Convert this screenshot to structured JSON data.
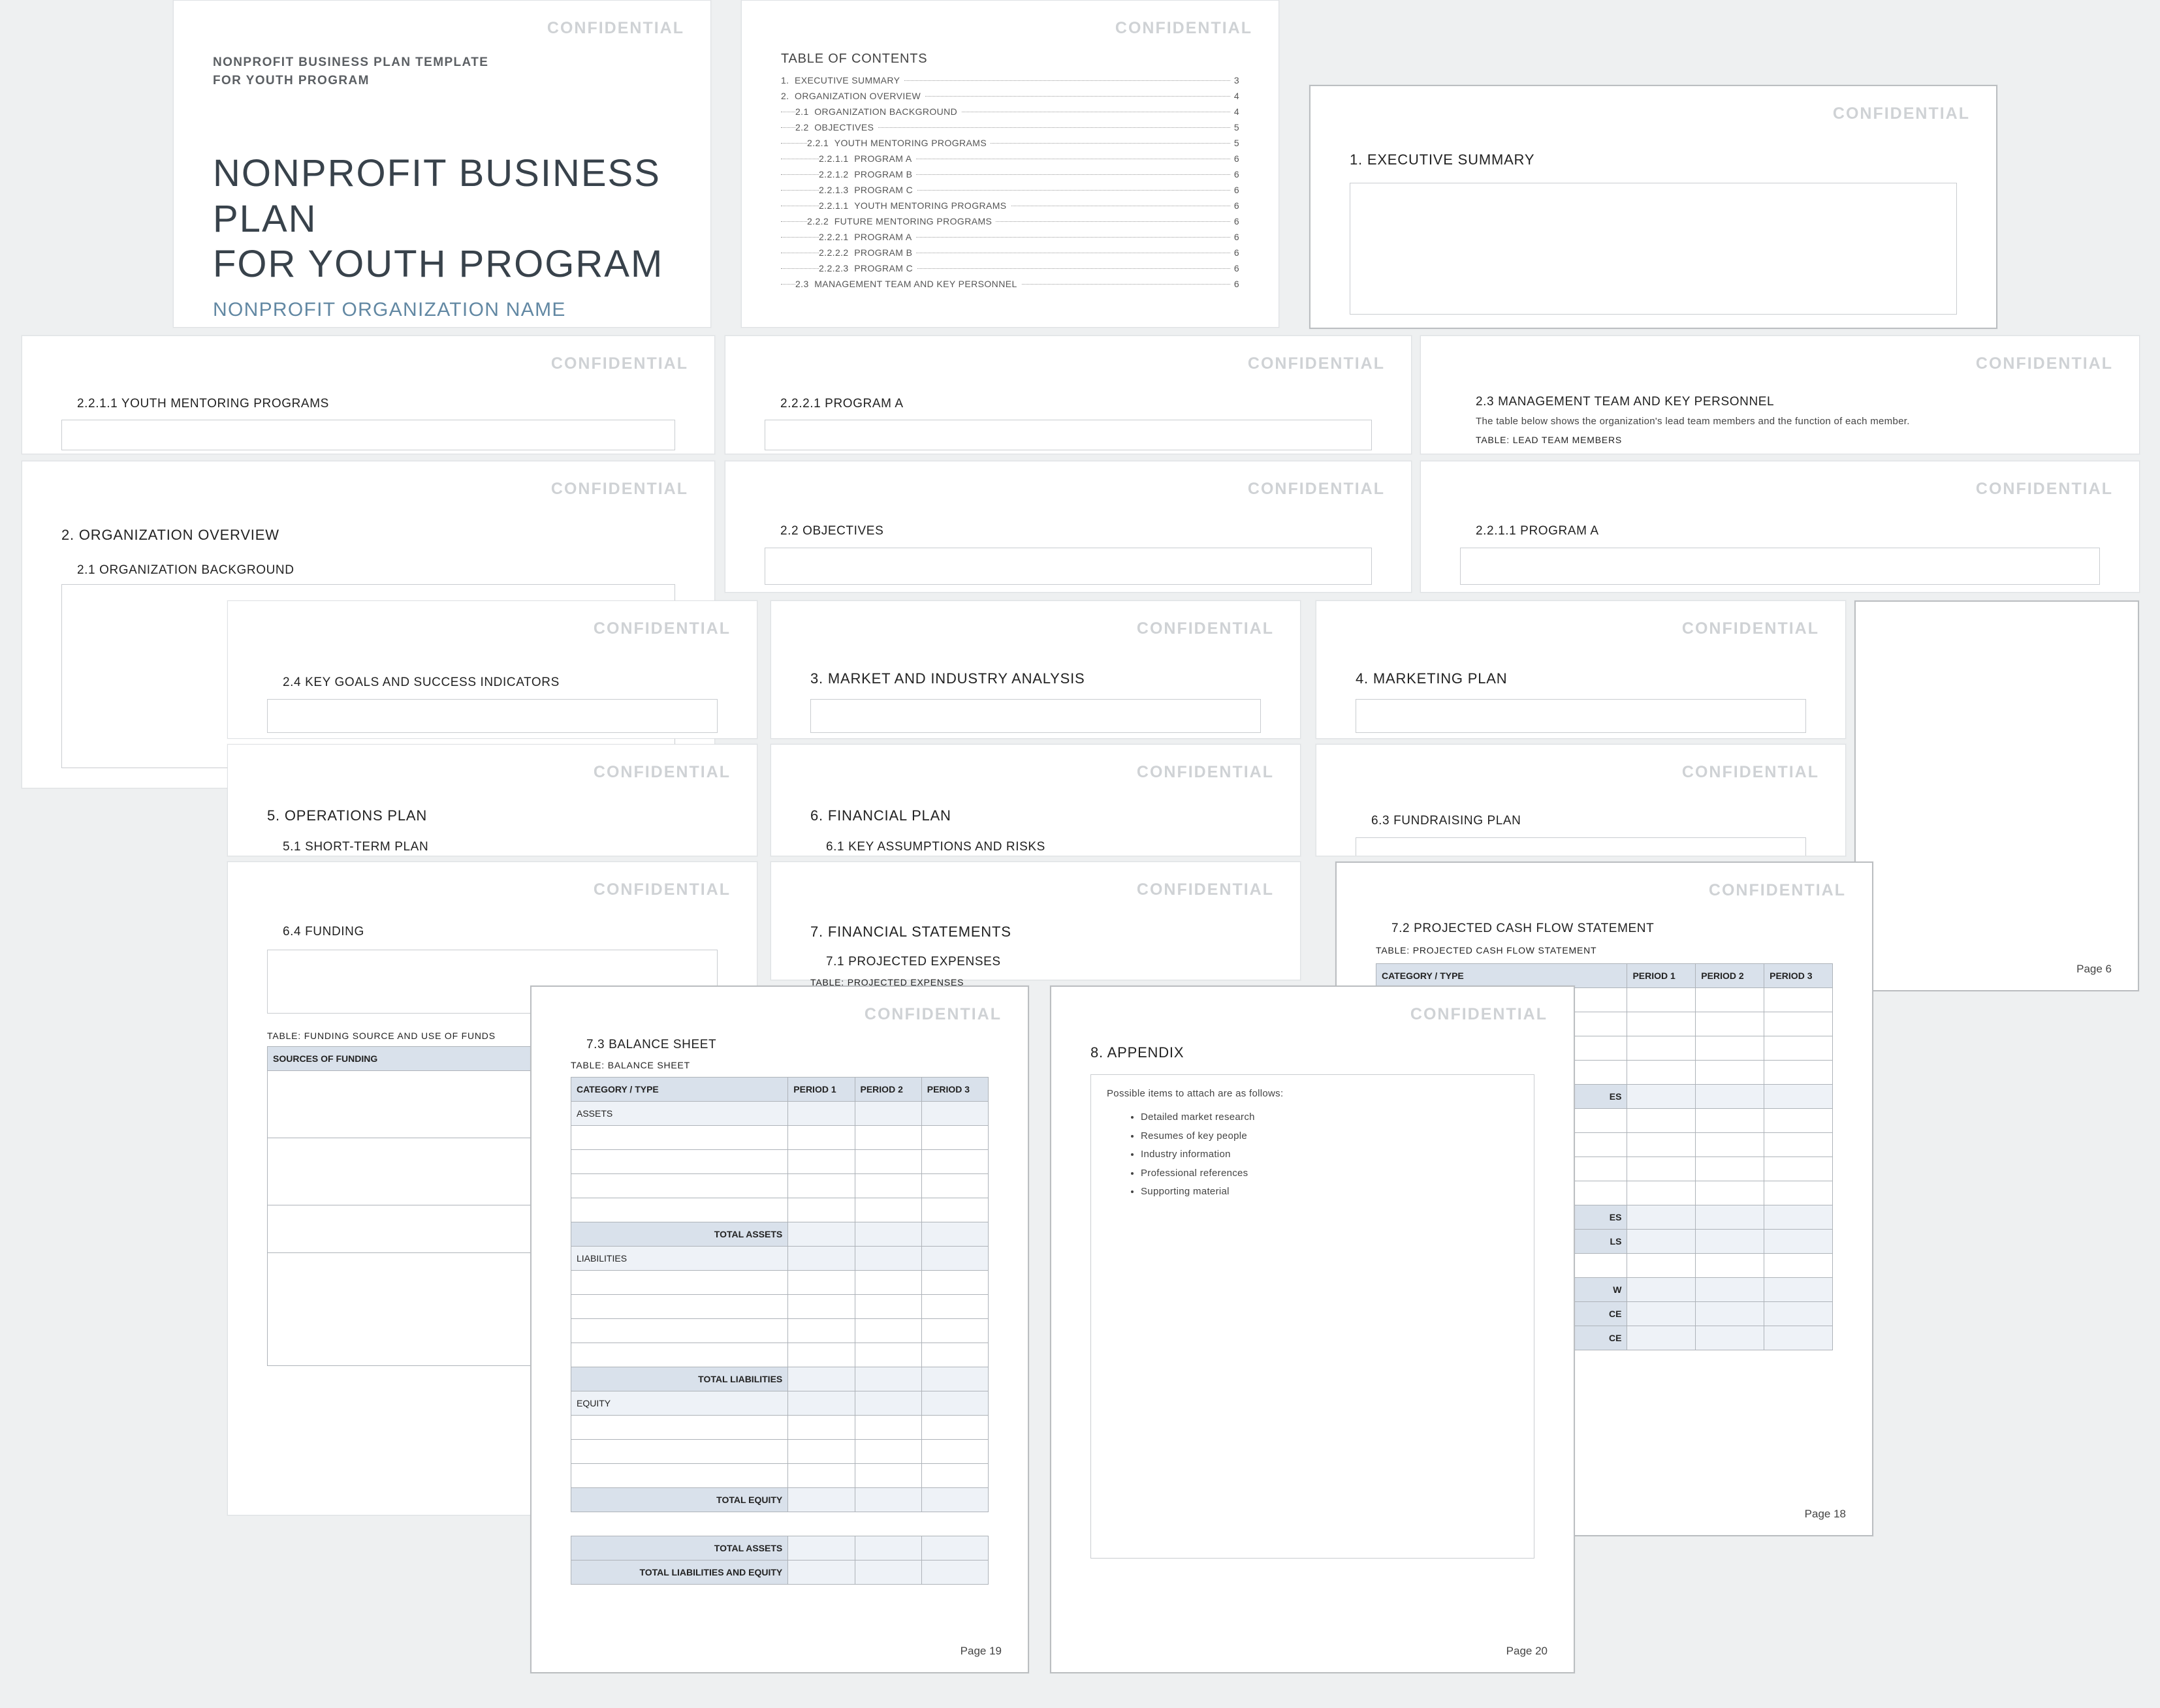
{
  "confidential": "CONFIDENTIAL",
  "cover": {
    "template_line1": "NONPROFIT BUSINESS PLAN TEMPLATE",
    "template_line2": "FOR YOUTH PROGRAM",
    "title_line1": "NONPROFIT BUSINESS PLAN",
    "title_line2": "FOR YOUTH PROGRAM",
    "org_name": "NONPROFIT ORGANIZATION NAME"
  },
  "toc": {
    "heading": "TABLE OF CONTENTS",
    "items": [
      {
        "n": "1.",
        "t": "EXECUTIVE SUMMARY",
        "p": "3"
      },
      {
        "n": "2.",
        "t": "ORGANIZATION OVERVIEW",
        "p": "4"
      },
      {
        "n": "2.1",
        "t": "ORGANIZATION BACKGROUND",
        "p": "4"
      },
      {
        "n": "2.2",
        "t": "OBJECTIVES",
        "p": "5"
      },
      {
        "n": "2.2.1",
        "t": "YOUTH MENTORING PROGRAMS",
        "p": "5"
      },
      {
        "n": "2.2.1.1",
        "t": "PROGRAM A",
        "p": "6"
      },
      {
        "n": "2.2.1.2",
        "t": "PROGRAM B",
        "p": "6"
      },
      {
        "n": "2.2.1.3",
        "t": "PROGRAM C",
        "p": "6"
      },
      {
        "n": "2.2.1.1",
        "t": "YOUTH MENTORING PROGRAMS",
        "p": "6"
      },
      {
        "n": "2.2.2",
        "t": "FUTURE MENTORING PROGRAMS",
        "p": "6"
      },
      {
        "n": "2.2.2.1",
        "t": "PROGRAM A",
        "p": "6"
      },
      {
        "n": "2.2.2.2",
        "t": "PROGRAM B",
        "p": "6"
      },
      {
        "n": "2.2.2.3",
        "t": "PROGRAM C",
        "p": "6"
      },
      {
        "n": "2.3",
        "t": "MANAGEMENT TEAM AND KEY PERSONNEL",
        "p": "6"
      }
    ]
  },
  "sections": {
    "exec_summary": "1.  EXECUTIVE SUMMARY",
    "youth_ment": "2.2.1.1   YOUTH MENTORING PROGRAMS",
    "p2221": "2.2.2.1   PROGRAM A",
    "mgmt_team": "2.3   MANAGEMENT TEAM AND KEY PERSONNEL",
    "mgmt_desc": "The table below shows the organization's lead team members and the function of each member.",
    "mgmt_table": "TABLE:  LEAD TEAM MEMBERS",
    "org_overview": "2. ORGANIZATION OVERVIEW",
    "org_bg": "2.1   ORGANIZATION BACKGROUND",
    "objectives": "2.2   OBJECTIVES",
    "p2211": "2.2.1.1   PROGRAM A",
    "key_goals": "2.4   KEY GOALS AND SUCCESS INDICATORS",
    "market": "3.  MARKET AND INDUSTRY ANALYSIS",
    "marketing": "4.  MARKETING PLAN",
    "ops": "5.  OPERATIONS PLAN",
    "short_term": "5.1   SHORT-TERM PLAN",
    "financial": "6.  FINANCIAL PLAN",
    "assumptions": "6.1   KEY ASSUMPTIONS AND RISKS",
    "fundraising": "6.3   FUNDRAISING PLAN",
    "funding": "6.4   FUNDING",
    "funding_table": "TABLE:  FUNDING SOURCE AND USE OF FUNDS",
    "funding_col": "SOURCES OF FUNDING",
    "fin_stmts": "7.  FINANCIAL STATEMENTS",
    "proj_exp": "7.1   PROJECTED EXPENSES",
    "proj_exp_tbl": "TABLE:  PROJECTED EXPENSES",
    "cash_flow": "7.2   PROJECTED CASH FLOW STATEMENT",
    "cash_flow_tbl": "TABLE:  PROJECTED CASH FLOW STATEMENT",
    "bal_sheet": "7.3   BALANCE SHEET",
    "bal_tbl": "TABLE:  BALANCE SHEET",
    "appendix": "8.  APPENDIX",
    "appendix_lead": "Possible items to attach are as follows:",
    "appendix_items": [
      "Detailed market research",
      "Resumes of key people",
      "Industry information",
      "Professional references",
      "Supporting material"
    ]
  },
  "table_hdr": {
    "cat": "CATEGORY / TYPE",
    "p1": "PERIOD 1",
    "p2": "PERIOD 2",
    "p3": "PERIOD 3"
  },
  "bal_rows": {
    "assets": "ASSETS",
    "tot_assets": "TOTAL ASSETS",
    "liab": "LIABILITIES",
    "tot_liab": "TOTAL LIABILITIES",
    "equity": "EQUITY",
    "tot_equity": "TOTAL EQUITY",
    "tot_assets2": "TOTAL ASSETS",
    "tot_liab_eq": "TOTAL LIABILITIES AND EQUITY"
  },
  "cf_frag": {
    "es": "ES",
    "ls": "LS",
    "w": "W",
    "ce": "CE"
  },
  "pagenums": {
    "p6": "Page 6",
    "p18": "Page 18",
    "p19": "Page 19",
    "p20": "Page 20"
  }
}
